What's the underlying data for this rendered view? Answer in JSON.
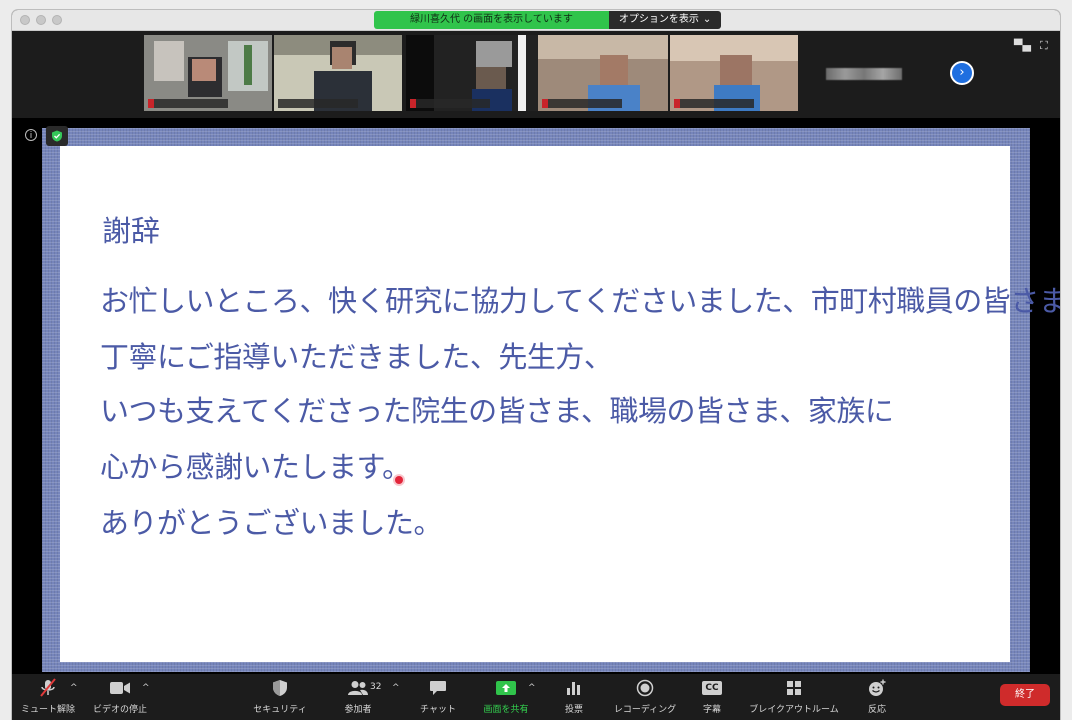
{
  "banner": {
    "share_text": "緑川喜久代 の画面を表示しています",
    "options_label": "オプションを表示"
  },
  "slide": {
    "heading": "謝辞",
    "lines": [
      "お忙しいところ、快く研究に協力してくださいました、市町村職員の皆さま、",
      "丁寧にご指導いただきました、先生方、",
      "いつも支えてくださった院生の皆さま、職場の皆さま、家族に",
      "心から感謝いたします。",
      "ありがとうございました。"
    ]
  },
  "toolbar": {
    "unmute": "ミュート解除",
    "stop_video": "ビデオの停止",
    "security": "セキュリティ",
    "participants": "参加者",
    "participants_count": "32",
    "chat": "チャット",
    "share_screen": "画面を共有",
    "polls": "投票",
    "recording": "レコーディング",
    "captions": "字幕",
    "captions_icon_text": "CC",
    "breakout": "ブレイクアウトルーム",
    "reactions": "反応",
    "end": "終了"
  },
  "icons": {
    "next": "chevron-right-icon",
    "shield": "shield-check-icon",
    "info": "info-icon"
  },
  "colors": {
    "share_green": "#30c44b",
    "slide_text": "#4b5aa6",
    "end_red": "#cf2b2b",
    "next_blue": "#1f6fe0"
  }
}
